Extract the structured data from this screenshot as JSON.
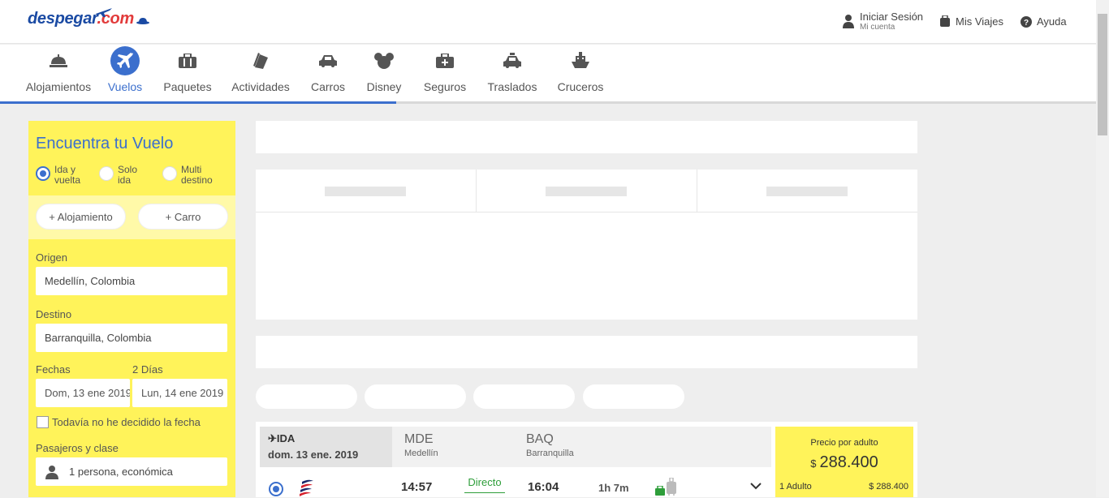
{
  "header": {
    "logo": {
      "brand": "despegar",
      "com": "com"
    },
    "signin": {
      "label": "Iniciar Sesión",
      "sub": "Mi cuenta"
    },
    "trips": "Mis Viajes",
    "help": "Ayuda"
  },
  "nav": {
    "items": [
      {
        "label": "Alojamientos",
        "icon": "bell-icon"
      },
      {
        "label": "Vuelos",
        "icon": "plane-icon",
        "active": true
      },
      {
        "label": "Paquetes",
        "icon": "suitcase-icon"
      },
      {
        "label": "Actividades",
        "icon": "tickets-icon"
      },
      {
        "label": "Carros",
        "icon": "car-icon"
      },
      {
        "label": "Disney",
        "icon": "mickey-icon"
      },
      {
        "label": "Seguros",
        "icon": "medkit-icon"
      },
      {
        "label": "Traslados",
        "icon": "taxi-icon"
      },
      {
        "label": "Cruceros",
        "icon": "ship-icon"
      }
    ],
    "accent": "#3b6fcd"
  },
  "search": {
    "title": "Encuentra tu Vuelo",
    "trip_types": [
      {
        "line1": "Ida y",
        "line2": "vuelta",
        "selected": true
      },
      {
        "line1": "Solo",
        "line2": "ida",
        "selected": false
      },
      {
        "line1": "Multi",
        "line2": "destino",
        "selected": false
      }
    ],
    "add_lodging": "+ Alojamiento",
    "add_car": "+ Carro",
    "origin_label": "Origen",
    "origin_value": "Medellín, Colombia",
    "dest_label": "Destino",
    "dest_value": "Barranquilla, Colombia",
    "dates_label": "Fechas",
    "days_label": "2 Días",
    "date_from": "Dom, 13 ene 2019",
    "date_to": "Lun, 14 ene 2019",
    "undecided_label": "Todavía no he decidido la fecha",
    "pax_label": "Pasajeros y clase",
    "pax_value": "1 persona, económica",
    "bg_color": "#fff35a"
  },
  "result": {
    "direction": "IDA",
    "date": "dom. 13 ene. 2019",
    "from_code": "MDE",
    "from_city": "Medellín",
    "to_code": "BAQ",
    "to_city": "Barranquilla",
    "depart": "14:57",
    "stops": "Directo",
    "arrive": "16:04",
    "duration": "1h 7m"
  },
  "price": {
    "label": "Precio por adulto",
    "currency": "$",
    "amount": "288.400",
    "row_label": "1 Adulto",
    "row_value": "$  288.400"
  }
}
